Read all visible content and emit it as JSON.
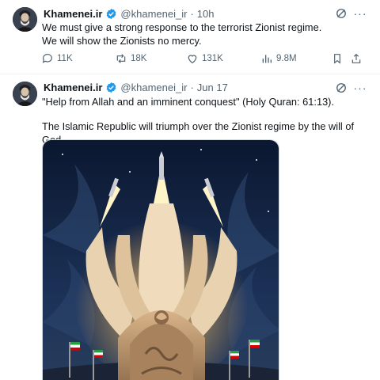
{
  "tweets": [
    {
      "author": {
        "name": "Khamenei.ir",
        "handle": "@khamenei_ir",
        "avatar_icon": "profile-photo-icon",
        "verified_icon": "verified-badge-icon"
      },
      "time": "10h",
      "lines": [
        "We must give a strong response to the terrorist Zionist regime.",
        "We will show the Zionists no mercy."
      ],
      "actions": {
        "replies": "11K",
        "reposts": "18K",
        "likes": "131K",
        "views": "9.8M"
      },
      "icons": [
        "reply-icon",
        "repost-icon",
        "like-icon",
        "views-icon",
        "bookmark-icon",
        "share-icon",
        "grok-icon",
        "more-icon"
      ]
    },
    {
      "author": {
        "name": "Khamenei.ir",
        "handle": "@khamenei_ir",
        "avatar_icon": "profile-photo-icon",
        "verified_icon": "verified-badge-icon"
      },
      "time": "Jun 17",
      "lines": [
        "\"Help from Allah and an imminent conquest\" (Holy Quran: 61:13).",
        "The Islamic Republic will triumph over the Zionist regime by the will of God."
      ],
      "media": {
        "type": "image",
        "subject": "missile-launch-illustration",
        "colors": {
          "sky": "#0f1e3a",
          "smoke": "#e8d2b0",
          "flame": "#ffb34a",
          "monument": "#b8926a"
        }
      }
    }
  ],
  "colors": {
    "text": "#0f1419",
    "muted": "#536471",
    "verified": "#1d9bf0",
    "divider": "#eff3f4"
  }
}
